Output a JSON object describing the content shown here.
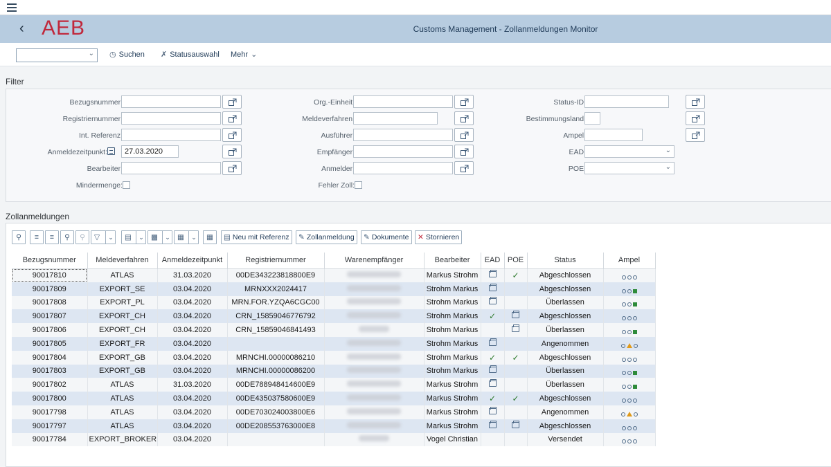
{
  "shell": {
    "logo": "AEB",
    "title": "Customs Management - Zollanmeldungen Monitor"
  },
  "toolbar": {
    "variant_value": "",
    "search_label": "Suchen",
    "status_label": "Statusauswahl",
    "more_label": "Mehr"
  },
  "filter": {
    "section_title": "Filter",
    "fields": {
      "bezugsnummer": "Bezugsnummer:",
      "registriernummer": "Registriernummer:",
      "int_referenz": "Int. Referenz:",
      "anmeldezeitpunkt": "Anmeldezeitpunkt:",
      "anmeldezeitpunkt_value": "27.03.2020",
      "bearbeiter": "Bearbeiter:",
      "mindermenge": "Mindermenge:",
      "org_einheit": "Org.-Einheit:",
      "meldeverfahren": "Meldeverfahren:",
      "ausfuehrer": "Ausführer:",
      "empfaenger": "Empfänger:",
      "anmelder": "Anmelder:",
      "fehler_zoll": "Fehler Zoll:",
      "status_id": "Status-ID:",
      "bestimmungsland": "Bestimmungsland:",
      "ampel": "Ampel:",
      "ead": "EAD:",
      "poe": "POE:"
    }
  },
  "grid": {
    "section_title": "Zollanmeldungen",
    "buttons": {
      "new_ref": "Neu mit Referenz",
      "zollanmeldung": "Zollanmeldung",
      "dokumente": "Dokumente",
      "stornieren": "Stornieren"
    },
    "columns": [
      "Bezugsnummer",
      "Meldeverfahren",
      "Anmeldezeitpunkt",
      "Registriernummer",
      "Warenempfänger",
      "Bearbeiter",
      "EAD",
      "POE",
      "Status",
      "Ampel"
    ],
    "rows": [
      {
        "bez": "90017810",
        "mv": "ATLAS",
        "zeit": "31.03.2020",
        "reg": "00DE343223818800E9",
        "bearb": "Markus Strohm",
        "ead": "printer",
        "poe": "check",
        "status": "Abgeschlossen",
        "ampel": "ooo"
      },
      {
        "bez": "90017809",
        "mv": "EXPORT_SE",
        "zeit": "03.04.2020",
        "reg": "MRNXXX2024417",
        "bearb": "Strohm Markus",
        "ead": "printer",
        "poe": "",
        "status": "Abgeschlossen",
        "ampel": "oog"
      },
      {
        "bez": "90017808",
        "mv": "EXPORT_PL",
        "zeit": "03.04.2020",
        "reg": "MRN.FOR.YZQA6CGC00",
        "bearb": "Strohm Markus",
        "ead": "printer",
        "poe": "",
        "status": "Überlassen",
        "ampel": "oog"
      },
      {
        "bez": "90017807",
        "mv": "EXPORT_CH",
        "zeit": "03.04.2020",
        "reg": "CRN_15859046776792",
        "bearb": "Strohm Markus",
        "ead": "check",
        "poe": "printer",
        "status": "Abgeschlossen",
        "ampel": "ooo"
      },
      {
        "bez": "90017806",
        "mv": "EXPORT_CH",
        "zeit": "03.04.2020",
        "reg": "CRN_15859046841493",
        "bearb": "Strohm Markus",
        "ead": "",
        "poe": "printer",
        "status": "Überlassen",
        "ampel": "oog"
      },
      {
        "bez": "90017805",
        "mv": "EXPORT_FR",
        "zeit": "03.04.2020",
        "reg": "",
        "bearb": "Strohm Markus",
        "ead": "printer",
        "poe": "",
        "status": "Angenommen",
        "ampel": "oao"
      },
      {
        "bez": "90017804",
        "mv": "EXPORT_GB",
        "zeit": "03.04.2020",
        "reg": "MRNCHI.00000086210",
        "bearb": "Strohm Markus",
        "ead": "check",
        "poe": "check",
        "status": "Abgeschlossen",
        "ampel": "ooo"
      },
      {
        "bez": "90017803",
        "mv": "EXPORT_GB",
        "zeit": "03.04.2020",
        "reg": "MRNCHI.00000086200",
        "bearb": "Strohm Markus",
        "ead": "printer",
        "poe": "",
        "status": "Überlassen",
        "ampel": "oog"
      },
      {
        "bez": "90017802",
        "mv": "ATLAS",
        "zeit": "31.03.2020",
        "reg": "00DE788948414600E9",
        "bearb": "Markus Strohm",
        "ead": "printer",
        "poe": "",
        "status": "Überlassen",
        "ampel": "oog"
      },
      {
        "bez": "90017800",
        "mv": "ATLAS",
        "zeit": "03.04.2020",
        "reg": "00DE435037580600E9",
        "bearb": "Markus Strohm",
        "ead": "check",
        "poe": "check",
        "status": "Abgeschlossen",
        "ampel": "ooo"
      },
      {
        "bez": "90017798",
        "mv": "ATLAS",
        "zeit": "03.04.2020",
        "reg": "00DE703024003800E6",
        "bearb": "Markus Strohm",
        "ead": "printer",
        "poe": "",
        "status": "Angenommen",
        "ampel": "oao"
      },
      {
        "bez": "90017797",
        "mv": "ATLAS",
        "zeit": "03.04.2020",
        "reg": "00DE208553763000E8",
        "bearb": "Markus Strohm",
        "ead": "printer",
        "poe": "printer",
        "status": "Abgeschlossen",
        "ampel": "ooo"
      },
      {
        "bez": "90017784",
        "mv": "EXPORT_BROKER",
        "zeit": "03.04.2020",
        "reg": "",
        "bearb": "Vogel Christian",
        "ead": "",
        "poe": "",
        "status": "Versendet",
        "ampel": "ooo"
      }
    ]
  }
}
